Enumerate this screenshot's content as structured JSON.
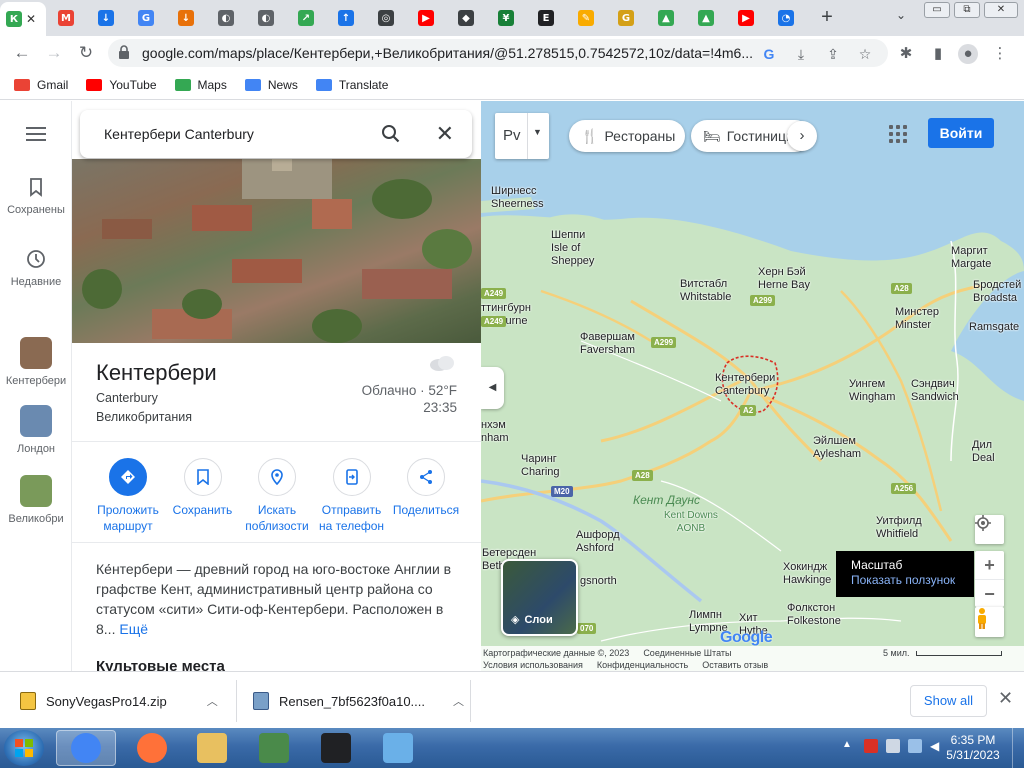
{
  "browser": {
    "tabs": [
      {
        "icon": "maps-icon",
        "label": "К",
        "color": "#34a853",
        "active": true
      },
      {
        "icon": "gmail-icon",
        "label": "M",
        "color": "#ea4335"
      },
      {
        "icon": "download-icon",
        "label": "↓",
        "color": "#1a73e8"
      },
      {
        "icon": "google-icon",
        "label": "G",
        "color": "#4285f4"
      },
      {
        "icon": "download-red-icon",
        "label": "↓",
        "color": "#e8710a"
      },
      {
        "icon": "site-icon",
        "label": "◐",
        "color": "#5f6368"
      },
      {
        "icon": "site-icon",
        "label": "◐",
        "color": "#5f6368"
      },
      {
        "icon": "share-icon",
        "label": "↗",
        "color": "#34a853"
      },
      {
        "icon": "upload-icon",
        "label": "↑",
        "color": "#1a73e8"
      },
      {
        "icon": "chrome-icon",
        "label": "◎",
        "color": "#3c4043"
      },
      {
        "icon": "youtube-icon",
        "label": "▶",
        "color": "#ff0000"
      },
      {
        "icon": "site-icon",
        "label": "◆",
        "color": "#3c4043"
      },
      {
        "icon": "sheets-icon",
        "label": "¥",
        "color": "#188038"
      },
      {
        "icon": "site-icon",
        "label": "E",
        "color": "#202124"
      },
      {
        "icon": "site-icon",
        "label": "✎",
        "color": "#f9ab00"
      },
      {
        "icon": "site-icon",
        "label": "G",
        "color": "#d4a017"
      },
      {
        "icon": "drive-icon",
        "label": "▲",
        "color": "#34a853"
      },
      {
        "icon": "drive-icon",
        "label": "▲",
        "color": "#34a853"
      },
      {
        "icon": "youtube-icon",
        "label": "▶",
        "color": "#ff0000"
      },
      {
        "icon": "loading-icon",
        "label": "◔",
        "color": "#1a73e8"
      }
    ],
    "new_tab": "+",
    "window_buttons": {
      "minimize": "▭",
      "maximize": "⧉",
      "close": "✕"
    },
    "url": "google.com/maps/place/Кентербери,+Великобритания/@51.278515,0.7542572,10z/data=!4m6...",
    "bookmarks": [
      {
        "label": "Gmail",
        "icon": "gmail-icon",
        "color": "#ea4335"
      },
      {
        "label": "YouTube",
        "icon": "youtube-icon",
        "color": "#ff0000"
      },
      {
        "label": "Maps",
        "icon": "maps-pin-icon",
        "color": "#34a853"
      },
      {
        "label": "News",
        "icon": "news-icon",
        "color": "#4285f4"
      },
      {
        "label": "Translate",
        "icon": "translate-icon",
        "color": "#4285f4"
      }
    ]
  },
  "rail": {
    "saved": "Сохранены",
    "recent": "Недавние",
    "places": [
      {
        "label": "Кентербери",
        "color": "#8a6a52"
      },
      {
        "label": "Лондон",
        "color": "#6a8ab0"
      },
      {
        "label": "Великобри",
        "color": "#7a9a5a"
      }
    ]
  },
  "panel": {
    "search_value": "Кентербери Canterbury",
    "title": "Кентербери",
    "subtitle": "Canterbury",
    "country": "Великобритания",
    "weather": "Облачно · 52°F",
    "time": "23:35",
    "actions": [
      {
        "label": "Проложить маршрут",
        "icon": "directions-icon"
      },
      {
        "label": "Сохранить",
        "icon": "bookmark-icon"
      },
      {
        "label": "Искать поблизости",
        "icon": "nearby-icon"
      },
      {
        "label": "Отправить на телефон",
        "icon": "phone-icon"
      },
      {
        "label": "Поделиться",
        "icon": "share-icon"
      }
    ],
    "description": "Ке́нтербери — древний город на юго-востоке Англии в графстве Кент, административный центр района со статусом «сити» Сити-оф-Кентербери. Расположен в 8...",
    "more": "Ещё",
    "section_title": "Культовые места"
  },
  "map": {
    "layer_type": "Рv",
    "chips": [
      {
        "label": "Рестораны",
        "icon": "restaurant-icon"
      },
      {
        "label": "Гостиницы",
        "icon": "hotel-icon"
      }
    ],
    "signin": "Войти",
    "layers_label": "Слои",
    "tooltip_title": "Масштаб",
    "tooltip_link": "Показать ползунок",
    "labels": {
      "sheerness_ru": "Ширнесс",
      "sheerness": "Sheerness",
      "sheppey_ru": "Шеппи",
      "sheppey_1": "Isle of",
      "sheppey_2": "Sheppey",
      "whitstable_ru": "Витстабл",
      "whitstable": "Whitstable",
      "hernebay_ru": "Херн Бэй",
      "hernebay": "Herne Bay",
      "margate_ru": "Маргит",
      "margate": "Margate",
      "broadstairs_ru": "Бродстей",
      "broadstairs": "Broadsta",
      "minster_ru": "Минстер",
      "minster": "Minster",
      "ramsgate": "Ramsgate",
      "sittingbourne_ru": "ттингбурн",
      "sittingbourne": "ngbourne",
      "faversham_ru": "Фавершам",
      "faversham": "Faversham",
      "canterbury_ru": "Кентербери",
      "canterbury": "Canterbury",
      "wingham_ru": "Уингем",
      "wingham": "Wingham",
      "sandwich_ru": "Сэндвич",
      "sandwich": "Sandwich",
      "lenham_ru": "нхэм",
      "lenham": "nham",
      "charing_ru": "Чаринг",
      "charing": "Charing",
      "aylesham_ru": "Эйлшем",
      "aylesham": "Aylesham",
      "deal_ru": "Дил",
      "deal": "Deal",
      "kentdowns_ru": "Кент Даунс",
      "kentdowns_1": "Kent Downs",
      "kentdowns_2": "AONB",
      "ashford_ru": "Ашфорд",
      "ashford": "Ashford",
      "whitfield_ru": "Уитфилд",
      "whitfield": "Whitfield",
      "bethersden_ru": "Бетерсден",
      "bethersden": "Beth",
      "hawkinge_ru": "Хокиндж",
      "hawkinge": "Hawkinge",
      "kingsnorth": "gsnorth",
      "folkestone_ru": "Фолкстон",
      "folkestone": "Folkestone",
      "lympne_ru": "Лимпн",
      "lympne": "Lympne",
      "hythe_ru": "Хит",
      "hythe": "Hythe"
    },
    "roads": {
      "a249a": "A249",
      "a249b": "A249",
      "a299a": "A299",
      "a299b": "A299",
      "a28a": "A28",
      "a28b": "A28",
      "a2": "A2",
      "m20": "M20",
      "a256": "A256",
      "a20": "A20",
      "a70": "070"
    },
    "footer": {
      "copyright": "Картографические данные ©, 2023",
      "region": "Соединенные Штаты",
      "terms": "Условия использования",
      "privacy": "Конфиденциальность",
      "feedback": "Оставить отзыв",
      "scale": "5 мил."
    },
    "google": "Google"
  },
  "downloads": {
    "items": [
      {
        "name": "SonyVegasPro14.zip",
        "icon": "zip-icon"
      },
      {
        "name": "Rensen_7bf5623f0a10....",
        "icon": "exe-icon"
      }
    ],
    "show_all": "Show all",
    "close": "✕"
  },
  "taskbar": {
    "time": "6:35 PM",
    "date": "5/31/2023",
    "apps": [
      {
        "name": "chrome-icon",
        "color": "#4285f4",
        "active": true
      },
      {
        "name": "firefox-icon",
        "color": "#ff7139"
      },
      {
        "name": "explorer-icon",
        "color": "#e8c060"
      },
      {
        "name": "monitor-icon",
        "color": "#4a8a4a"
      },
      {
        "name": "7zip-icon",
        "color": "#202124"
      },
      {
        "name": "control-panel-icon",
        "color": "#6ab0e8"
      }
    ]
  }
}
